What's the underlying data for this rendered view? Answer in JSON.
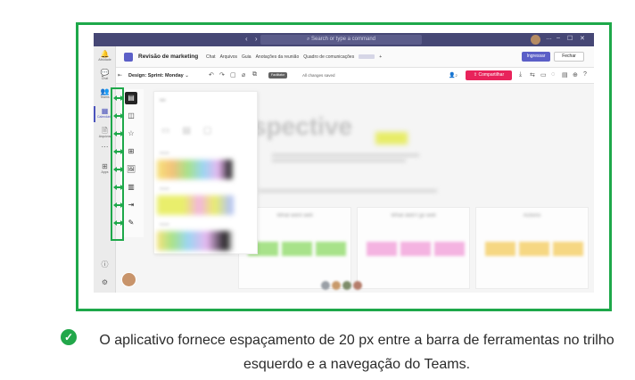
{
  "window": {
    "nav_arrows": "‹ ›",
    "search_placeholder": "Search or type a command",
    "controls": [
      "…",
      "–",
      "☐",
      "✕"
    ]
  },
  "rail": {
    "items": [
      {
        "icon": "bell-icon",
        "glyph": "🔔",
        "label": "Atividade"
      },
      {
        "icon": "chat-icon",
        "glyph": "💬",
        "label": "Chat"
      },
      {
        "icon": "teams-icon",
        "glyph": "👥",
        "label": "Teams"
      },
      {
        "icon": "calendar-icon",
        "glyph": "▦",
        "label": "Calendário"
      },
      {
        "icon": "files-icon",
        "glyph": "🗎",
        "label": "Arquivos"
      },
      {
        "icon": "more-icon",
        "glyph": "⋯",
        "label": ""
      },
      {
        "icon": "apps-icon",
        "glyph": "⊞",
        "label": "Apps"
      }
    ]
  },
  "channel": {
    "name": "Revisão de marketing",
    "tabs": [
      "Chat",
      "Arquivos",
      "Guia",
      "Anotações da reunião",
      "Quadro de comunicações"
    ],
    "add_tab": "+",
    "join_label": "Ingressar",
    "close_label": "Fechar"
  },
  "toolbar": {
    "design_label": "Design:",
    "board_name": "Sprint: Monday",
    "facilitator": "Facilitator",
    "saved_status": "All changes saved",
    "user_count": "2",
    "share_label": "Compartilhar"
  },
  "canvas": {
    "title": "spective",
    "col_titles": [
      "What went well",
      "What didn't go well",
      "Actions"
    ]
  },
  "tools": [
    {
      "name": "sticky-note-icon",
      "glyph": "▤"
    },
    {
      "name": "shapes-icon",
      "glyph": "◫"
    },
    {
      "name": "star-icon",
      "glyph": "☆"
    },
    {
      "name": "table-icon",
      "glyph": "⊞"
    },
    {
      "name": "image-icon",
      "glyph": "🖼"
    },
    {
      "name": "library-icon",
      "glyph": "▥"
    },
    {
      "name": "export-icon",
      "glyph": "⇥"
    },
    {
      "name": "pen-icon",
      "glyph": "✎"
    }
  ],
  "caption": "O aplicativo fornece espaçamento de 20 px entre a barra de ferramentas no trilho esquerdo e a navegação do Teams.",
  "colors": {
    "highlight": "#1ea84a",
    "teams_purple": "#464775",
    "share_pink": "#e8235b",
    "join_blue": "#5b5fc7"
  }
}
